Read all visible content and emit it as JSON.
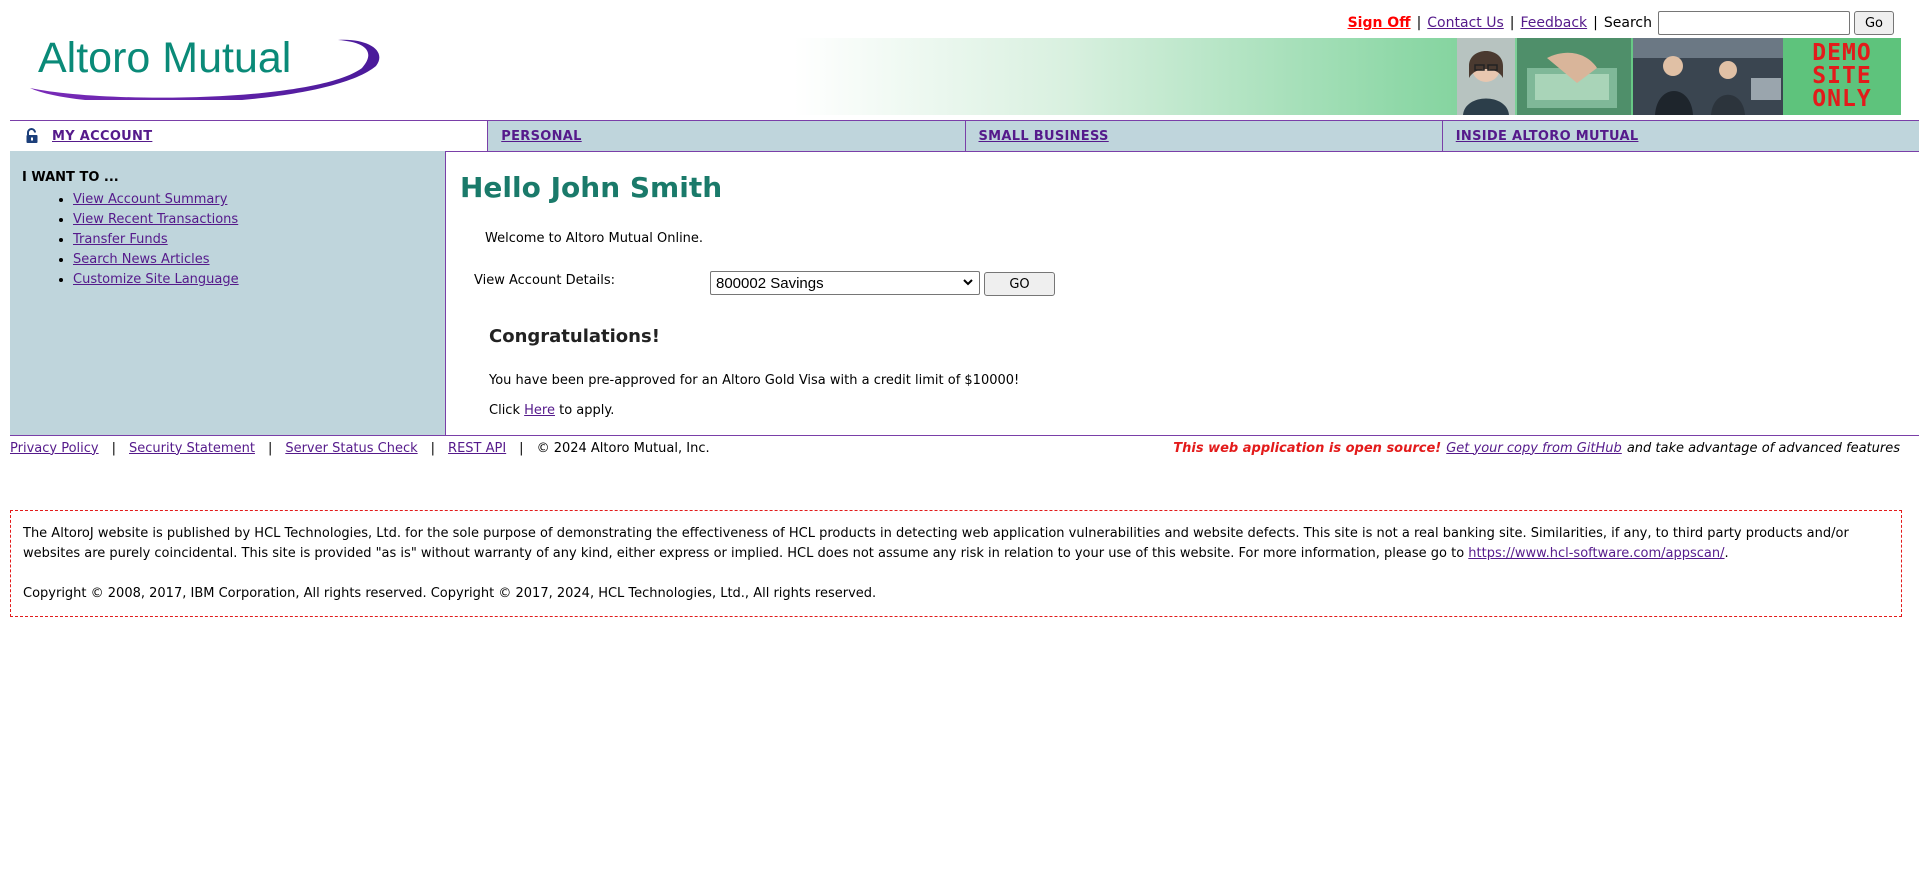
{
  "brand": {
    "name": "Altoro Mutual",
    "part1": "Altoro",
    "part2": "Mutual",
    "colors": {
      "teal": "#0a8a78",
      "green": "#2aa86a",
      "purple": "#5b1ea3",
      "nav_bg": "#bfd5dc",
      "nav_border": "#7a3fa8",
      "red": "#e31b1b"
    }
  },
  "top_links": {
    "sign_off": "Sign Off",
    "sep": "|",
    "contact": "Contact Us",
    "feedback": "Feedback",
    "search_label": "Search",
    "search_value": "",
    "go_label": "Go"
  },
  "banner": {
    "demo_line1": "DEMO",
    "demo_line2": "SITE",
    "demo_line3": "ONLY"
  },
  "nav": {
    "lock_icon": "lock-icon",
    "my_account": "MY ACCOUNT",
    "personal": "PERSONAL",
    "small_business": "SMALL BUSINESS",
    "inside": "INSIDE ALTORO MUTUAL"
  },
  "sidebar": {
    "title": "I WANT TO ...",
    "items": [
      {
        "label": "View Account Summary"
      },
      {
        "label": "View Recent Transactions"
      },
      {
        "label": "Transfer Funds"
      },
      {
        "label": "Search News Articles"
      },
      {
        "label": "Customize Site Language"
      }
    ]
  },
  "main": {
    "greeting": "Hello John Smith",
    "welcome": "Welcome to Altoro Mutual Online.",
    "account_label": "View Account Details:",
    "account_selected": "800002 Savings",
    "account_go": "GO",
    "congrats": "Congratulations!",
    "preapproved": "You have been pre-approved for an Altoro Gold Visa with a credit limit of $10000!",
    "click_prefix": "Click",
    "here": "Here",
    "click_suffix": "to apply."
  },
  "footer": {
    "privacy": "Privacy Policy",
    "security": "Security Statement",
    "status": "Server Status Check",
    "rest": "REST API",
    "sep": "|",
    "copyright": "© 2024 Altoro Mutual, Inc.",
    "open_source": "This web application is open source!",
    "github": "Get your copy from GitHub",
    "advantage": "and take advantage of advanced features"
  },
  "disclaimer": {
    "text": "The AltoroJ website is published by HCL Technologies, Ltd. for the sole purpose of demonstrating the effectiveness of HCL products in detecting web application vulnerabilities and website defects. This site is not a real banking site. Similarities, if any, to third party products and/or websites are purely coincidental. This site is provided \"as is\" without warranty of any kind, either express or implied. HCL does not assume any risk in relation to your use of this website. For more information, please go to",
    "link": "https://www.hcl-software.com/appscan/",
    "period": ".",
    "copyright": "Copyright © 2008, 2017, IBM Corporation, All rights reserved. Copyright © 2017, 2024, HCL Technologies, Ltd., All rights reserved."
  }
}
